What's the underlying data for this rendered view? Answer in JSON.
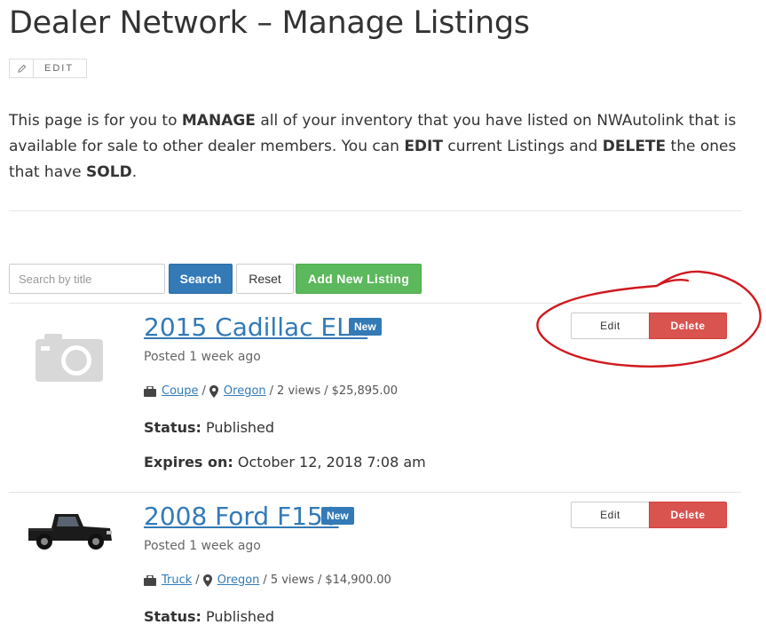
{
  "page": {
    "title": "Dealer Network – Manage Listings",
    "edit_label": "EDIT",
    "intro": {
      "p1": "This page is for you to ",
      "manage": "MANAGE",
      "p2": " all of your inventory that you have listed on NWAutolink that is available for sale to other dealer members.  You can ",
      "edit": "EDIT",
      "p3": " current Listings and ",
      "delete": "DELETE",
      "p4": " the ones that have ",
      "sold": "SOLD",
      "p5": "."
    }
  },
  "toolbar": {
    "search_placeholder": "Search by title",
    "search_label": "Search",
    "reset_label": "Reset",
    "add_label": "Add New Listing"
  },
  "listings": [
    {
      "title": "2015 Cadillac ELR",
      "badge": "New",
      "posted": "Posted 1 week ago",
      "category": "Coupe",
      "location": "Oregon",
      "views": "2 views",
      "price": "$25,895.00",
      "status_label": "Status:",
      "status_value": " Published",
      "expires_label": "Expires on:",
      "expires_value": " October 12, 2018 7:08 am",
      "edit_label": "Edit",
      "delete_label": "Delete",
      "thumb_icon": "camera-placeholder-icon"
    },
    {
      "title": "2008 Ford F150",
      "badge": "New",
      "posted": "Posted 1 week ago",
      "category": "Truck",
      "location": "Oregon",
      "views": "5 views",
      "price": "$14,900.00",
      "status_label": "Status:",
      "status_value": " Published",
      "edit_label": "Edit",
      "delete_label": "Delete",
      "thumb_icon": "pickup-truck-image"
    }
  ],
  "meta_separator": "/",
  "colors": {
    "primary": "#337ab7",
    "success": "#5cb85c",
    "danger": "#d9534f",
    "annotation": "#d0191f"
  }
}
